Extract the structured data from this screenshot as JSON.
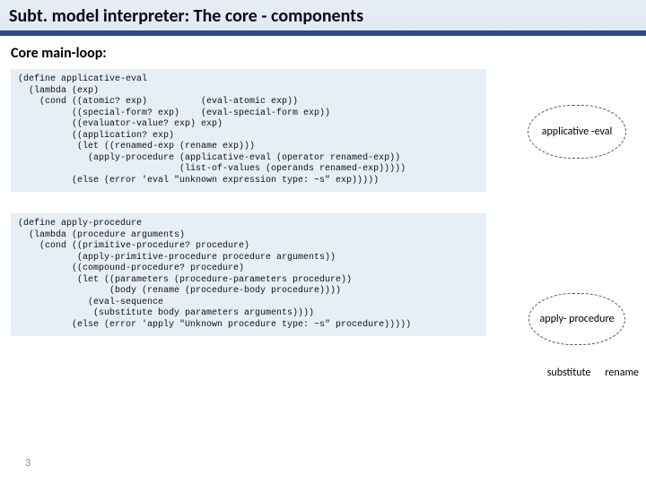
{
  "title": "Subt. model interpreter:   The core - components",
  "subheading": "Core main-loop:",
  "code1": "(define applicative-eval\n  (lambda (exp)\n    (cond ((atomic? exp)          (eval-atomic exp))\n          ((special-form? exp)    (eval-special-form exp))\n          ((evaluator-value? exp) exp)\n          ((application? exp)\n           (let ((renamed-exp (rename exp)))\n             (apply-procedure (applicative-eval (operator renamed-exp))\n                              (list-of-values (operands renamed-exp)))))\n          (else (error 'eval \"unknown expression type: ~s\" exp)))))",
  "code2": "(define apply-procedure\n  (lambda (procedure arguments)\n    (cond ((primitive-procedure? procedure)\n           (apply-primitive-procedure procedure arguments))\n          ((compound-procedure? procedure)\n           (let ((parameters (procedure-parameters procedure))\n                 (body (rename (procedure-body procedure))))\n             (eval-sequence\n              (substitute body parameters arguments))))\n          (else (error 'apply \"Unknown procedure type: ~s\" procedure)))))",
  "cloud1": "applicative\n-eval",
  "cloud2": "apply-\nprocedure",
  "sidelabel1": "substitute",
  "sidelabel2": "rename",
  "page": "3"
}
